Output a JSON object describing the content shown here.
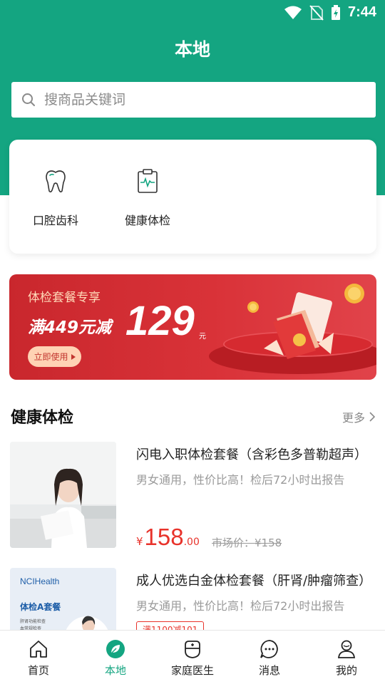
{
  "status_bar": {
    "time": "7:44"
  },
  "header": {
    "title": "本地"
  },
  "search": {
    "placeholder": "搜商品关键词"
  },
  "categories": [
    {
      "label": "口腔齿科",
      "icon": "tooth-icon"
    },
    {
      "label": "健康体检",
      "icon": "clipboard-health-icon"
    }
  ],
  "banner": {
    "title": "体检套餐专享",
    "subtitle": "满449元减",
    "amount": "129",
    "unit": "元",
    "button": "立即使用"
  },
  "section": {
    "title": "健康体检",
    "more": "更多"
  },
  "products": [
    {
      "name": "闪电入职体检套餐（含彩色多普勒超声）",
      "desc": "男女通用，性价比高！检后72小时出报告",
      "currency": "¥",
      "price_int": "158",
      "price_dec": ".00",
      "market_price": "市场价：¥158"
    },
    {
      "name": "成人优选白金体检套餐（肝肾/肿瘤筛查）",
      "desc": "男女通用，性价比高！检后72小时出报告",
      "coupon": "满1100减101",
      "thumb_brand": "NCIHealth",
      "thumb_title": "体检A套餐",
      "thumb_sub1": "肝肾功能检查",
      "thumb_sub2": "血常规检查"
    }
  ],
  "tabbar": [
    {
      "label": "首页",
      "icon": "home-icon"
    },
    {
      "label": "本地",
      "icon": "leaf-icon",
      "active": true
    },
    {
      "label": "家庭医生",
      "icon": "doctor-icon"
    },
    {
      "label": "消息",
      "icon": "message-icon"
    },
    {
      "label": "我的",
      "icon": "user-icon"
    }
  ],
  "colors": {
    "brand": "#14a581",
    "price": "#e8332b",
    "banner": "#d93238"
  }
}
